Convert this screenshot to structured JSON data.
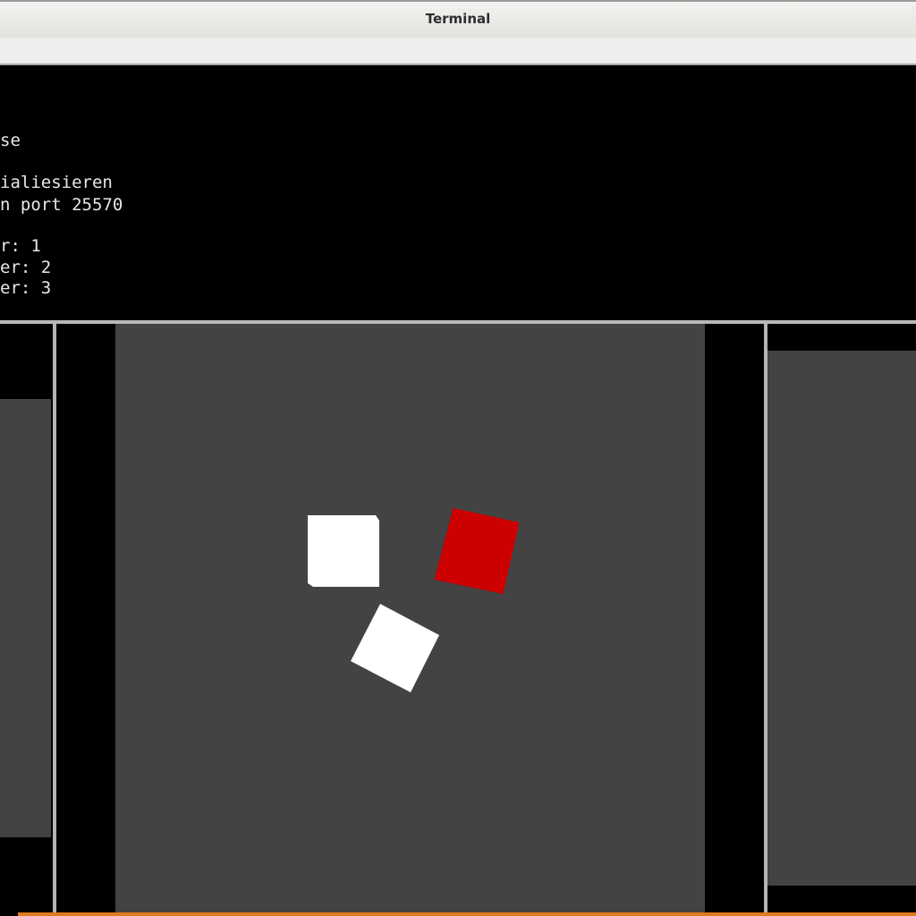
{
  "window": {
    "title": "Terminal"
  },
  "terminal": {
    "lines": [
      "se",
      "ialiesieren",
      "n port 25570",
      "r: 1",
      "er: 2",
      "er: 3"
    ],
    "foreground_color": "#e8e8e8",
    "background_color": "#000000"
  },
  "game": {
    "viewport_color": "#434343",
    "cubes": [
      {
        "name": "white cube",
        "color": "#ffffff"
      },
      {
        "name": "red cube",
        "color": "#cc0000"
      },
      {
        "name": "white cube",
        "color": "#ffffff"
      }
    ]
  }
}
